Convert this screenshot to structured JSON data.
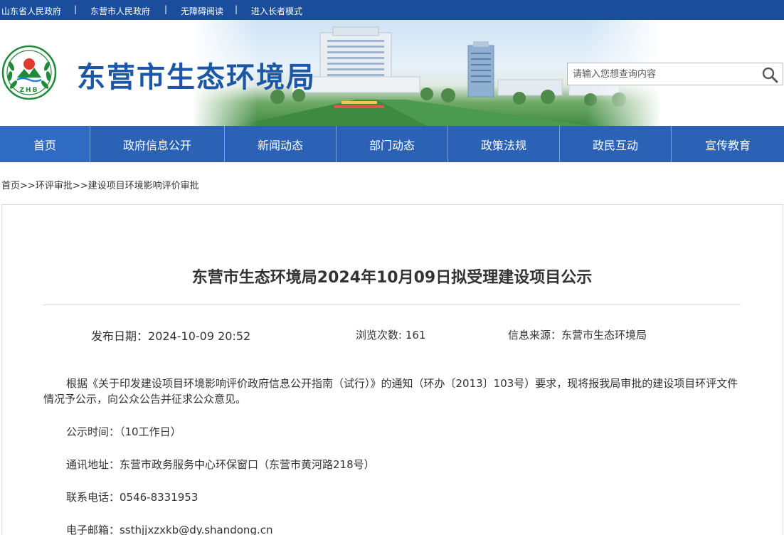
{
  "top_links": [
    "山东省人民政府",
    "东营市人民政府",
    "无障碍阅读",
    "进入长者模式"
  ],
  "site": {
    "title": "东营市生态环境局",
    "logo_text": "ZHB"
  },
  "search": {
    "placeholder": "请输入您想查询内容"
  },
  "nav": [
    "首页",
    "政府信息公开",
    "新闻动态",
    "部门动态",
    "政策法规",
    "政民互动",
    "宣传教育"
  ],
  "breadcrumb": [
    "首页",
    ">>",
    "环评审批",
    ">>",
    "建设项目环境影响评价审批"
  ],
  "article": {
    "title": "东营市生态环境局2024年10月09日拟受理建设项目公示",
    "publish_label": "发布日期：",
    "publish_date": "2024-10-09 20:52",
    "views_label": "浏览次数: ",
    "views": "161",
    "source_label": "信息来源：",
    "source": "东营市生态环境局",
    "intro": "根据《关于印发建设项目环境影响评价政府信息公开指南（试行）》的通知（环办〔2013〕103号）要求，现将报我局审批的建设项目环评文件情况予公示，向公众公告并征求公众意见。",
    "period": "公示时间：（10工作日）",
    "address": "通讯地址：东营市政务服务中心环保窗口（东营市黄河路218号）",
    "phone": "联系电话：0546-8331953",
    "email": "电子邮箱：ssthjjxzxkb@dy.shandong.cn"
  },
  "colors": {
    "topbar": "#1a4e9c",
    "nav": "#2b62b5",
    "title": "#1b57a6"
  }
}
